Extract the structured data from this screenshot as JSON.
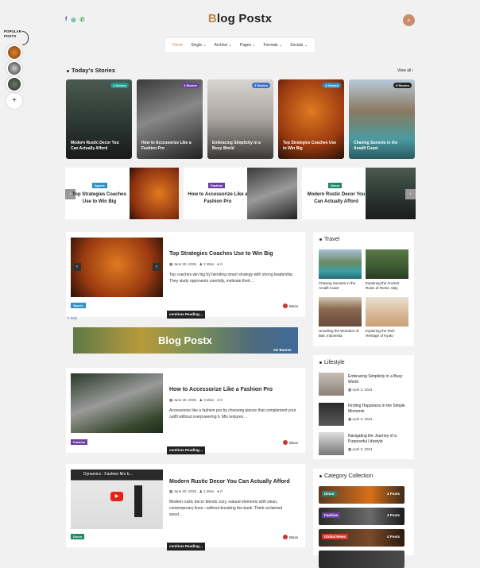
{
  "site": {
    "logo_first": "B",
    "logo_rest": "log Postx",
    "social": [
      "f",
      "◎",
      "✆"
    ]
  },
  "nav": [
    "Home",
    "Single ⌄",
    "Archive ⌄",
    "Pages ⌄",
    "Formats ⌄",
    "Socials ⌄"
  ],
  "popular_label": "POPULAR POSTS",
  "stories": {
    "title": "Today's Stories",
    "view_all": "View all ›",
    "items": [
      {
        "badge": "4 Stories",
        "title": "Modern Rustic Decor You Can Actually Afford",
        "badge_color": "#1a9a8a"
      },
      {
        "badge": "4 Stories",
        "title": "How to Accessorize Like a Fashion Pro",
        "badge_color": "#6b3fa0"
      },
      {
        "badge": "3 Stories",
        "title": "Embracing Simplicity in a Busy World",
        "badge_color": "#3b6fd0"
      },
      {
        "badge": "4 Stories",
        "title": "Top Strategies Coaches Use to Win Big",
        "badge_color": "#2f8fc8"
      },
      {
        "badge": "5 Stories",
        "title": "Chasing Sunsets in the Amalfi Coast",
        "badge_color": "#222"
      }
    ]
  },
  "slider": [
    {
      "tag": "Sports",
      "title": "Top Strategies Coaches Use to Win Big",
      "tag_color": "#2f8fc8"
    },
    {
      "tag": "Fashion",
      "title": "How to Accessorize Like a Fashion Pro",
      "tag_color": "#6b3fa0"
    },
    {
      "tag": "Decor",
      "title": "Modern Rustic Decor You Can Actually Afford",
      "tag_color": "#1a8a6a"
    }
  ],
  "posts": [
    {
      "title": "Top Strategies Coaches Use to Win Big",
      "date": "June 30, 2025",
      "read": "2 Mins",
      "comments": "0",
      "excerpt": "Top coaches win big by blending smart strategy with strong leadership. They study opponents carefully, motivate their…",
      "cat": "Sports",
      "cat_color": "#2f8fc8",
      "author": "Blaze",
      "more": "continue Reading…"
    },
    {
      "title": "How to Accessorize Like a Fashion Pro",
      "date": "June 30, 2025",
      "read": "3 Mins",
      "comments": "0",
      "excerpt": "Accessorize like a fashion pro by choosing pieces that complement your outfit without overpowering it. Mix textures…",
      "cat": "Fashion",
      "cat_color": "#6b3fa0",
      "author": "Blaze",
      "more": "continue Reading…"
    },
    {
      "title": "Modern Rustic Decor You Can Actually Afford",
      "date": "June 30, 2025",
      "read": "1 Mins",
      "comments": "0",
      "excerpt": "Modern rustic decor blends cozy, natural elements with clean, contemporary lines—without breaking the bank. Think reclaimed wood…",
      "cat": "Decor",
      "cat_color": "#1a8a6a",
      "author": "Blaze",
      "more": "continue Reading…",
      "video_title": "Dynamics - Fashion film b…"
    }
  ],
  "edit": "✎ Edit",
  "ad": {
    "title": "Blog Postx",
    "sub": "AD Banner"
  },
  "travel": {
    "title": "Travel",
    "items": [
      {
        "title": "Chasing Sunsets in the Amalfi Coast"
      },
      {
        "title": "Exploring the Ancient Ruins of Rome, Italy"
      },
      {
        "title": "Unveiling the Wonders of Bali, Indonesia"
      },
      {
        "title": "Exploring the Rich Heritage of Kyoto"
      }
    ]
  },
  "lifestyle": {
    "title": "Lifestyle",
    "items": [
      {
        "title": "Embracing Simplicity in a Busy World",
        "date": "April 3, 2024"
      },
      {
        "title": "Finding Happiness in the Simple Moments",
        "date": "April 3, 2024"
      },
      {
        "title": "Navigating the Journey of a Purposeful Lifestyle",
        "date": "April 3, 2024"
      }
    ]
  },
  "categories": {
    "title": "Category Collection",
    "items": [
      {
        "name": "Decor",
        "count": "4 Posts",
        "color": "#1a8a6a"
      },
      {
        "name": "Fashion",
        "count": "4 Posts",
        "color": "#6b3fa0"
      },
      {
        "name": "Global News",
        "count": "4 Posts",
        "color": "#d83a2a"
      },
      {
        "name": "",
        "count": "",
        "color": "#333"
      }
    ]
  }
}
